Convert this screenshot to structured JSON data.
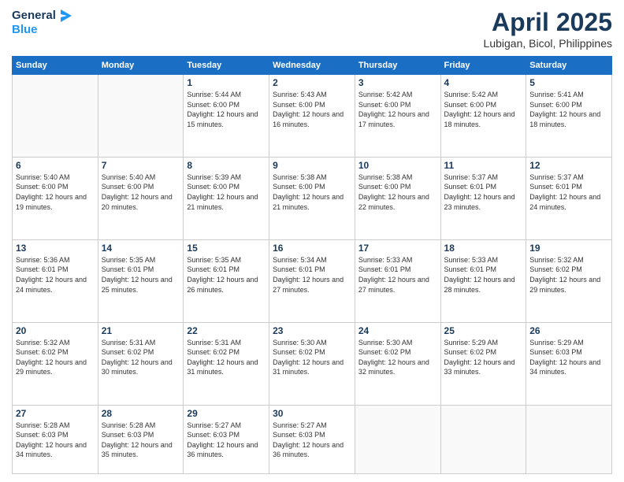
{
  "logo": {
    "line1": "General",
    "line2": "Blue"
  },
  "title": {
    "month": "April 2025",
    "location": "Lubigan, Bicol, Philippines"
  },
  "weekdays": [
    "Sunday",
    "Monday",
    "Tuesday",
    "Wednesday",
    "Thursday",
    "Friday",
    "Saturday"
  ],
  "days": [
    {
      "num": "",
      "info": ""
    },
    {
      "num": "",
      "info": ""
    },
    {
      "num": "1",
      "sunrise": "5:44 AM",
      "sunset": "6:00 PM",
      "daylight": "12 hours and 15 minutes."
    },
    {
      "num": "2",
      "sunrise": "5:43 AM",
      "sunset": "6:00 PM",
      "daylight": "12 hours and 16 minutes."
    },
    {
      "num": "3",
      "sunrise": "5:42 AM",
      "sunset": "6:00 PM",
      "daylight": "12 hours and 17 minutes."
    },
    {
      "num": "4",
      "sunrise": "5:42 AM",
      "sunset": "6:00 PM",
      "daylight": "12 hours and 18 minutes."
    },
    {
      "num": "5",
      "sunrise": "5:41 AM",
      "sunset": "6:00 PM",
      "daylight": "12 hours and 18 minutes."
    },
    {
      "num": "6",
      "sunrise": "5:40 AM",
      "sunset": "6:00 PM",
      "daylight": "12 hours and 19 minutes."
    },
    {
      "num": "7",
      "sunrise": "5:40 AM",
      "sunset": "6:00 PM",
      "daylight": "12 hours and 20 minutes."
    },
    {
      "num": "8",
      "sunrise": "5:39 AM",
      "sunset": "6:00 PM",
      "daylight": "12 hours and 21 minutes."
    },
    {
      "num": "9",
      "sunrise": "5:38 AM",
      "sunset": "6:00 PM",
      "daylight": "12 hours and 21 minutes."
    },
    {
      "num": "10",
      "sunrise": "5:38 AM",
      "sunset": "6:00 PM",
      "daylight": "12 hours and 22 minutes."
    },
    {
      "num": "11",
      "sunrise": "5:37 AM",
      "sunset": "6:01 PM",
      "daylight": "12 hours and 23 minutes."
    },
    {
      "num": "12",
      "sunrise": "5:37 AM",
      "sunset": "6:01 PM",
      "daylight": "12 hours and 24 minutes."
    },
    {
      "num": "13",
      "sunrise": "5:36 AM",
      "sunset": "6:01 PM",
      "daylight": "12 hours and 24 minutes."
    },
    {
      "num": "14",
      "sunrise": "5:35 AM",
      "sunset": "6:01 PM",
      "daylight": "12 hours and 25 minutes."
    },
    {
      "num": "15",
      "sunrise": "5:35 AM",
      "sunset": "6:01 PM",
      "daylight": "12 hours and 26 minutes."
    },
    {
      "num": "16",
      "sunrise": "5:34 AM",
      "sunset": "6:01 PM",
      "daylight": "12 hours and 27 minutes."
    },
    {
      "num": "17",
      "sunrise": "5:33 AM",
      "sunset": "6:01 PM",
      "daylight": "12 hours and 27 minutes."
    },
    {
      "num": "18",
      "sunrise": "5:33 AM",
      "sunset": "6:01 PM",
      "daylight": "12 hours and 28 minutes."
    },
    {
      "num": "19",
      "sunrise": "5:32 AM",
      "sunset": "6:02 PM",
      "daylight": "12 hours and 29 minutes."
    },
    {
      "num": "20",
      "sunrise": "5:32 AM",
      "sunset": "6:02 PM",
      "daylight": "12 hours and 29 minutes."
    },
    {
      "num": "21",
      "sunrise": "5:31 AM",
      "sunset": "6:02 PM",
      "daylight": "12 hours and 30 minutes."
    },
    {
      "num": "22",
      "sunrise": "5:31 AM",
      "sunset": "6:02 PM",
      "daylight": "12 hours and 31 minutes."
    },
    {
      "num": "23",
      "sunrise": "5:30 AM",
      "sunset": "6:02 PM",
      "daylight": "12 hours and 31 minutes."
    },
    {
      "num": "24",
      "sunrise": "5:30 AM",
      "sunset": "6:02 PM",
      "daylight": "12 hours and 32 minutes."
    },
    {
      "num": "25",
      "sunrise": "5:29 AM",
      "sunset": "6:02 PM",
      "daylight": "12 hours and 33 minutes."
    },
    {
      "num": "26",
      "sunrise": "5:29 AM",
      "sunset": "6:03 PM",
      "daylight": "12 hours and 34 minutes."
    },
    {
      "num": "27",
      "sunrise": "5:28 AM",
      "sunset": "6:03 PM",
      "daylight": "12 hours and 34 minutes."
    },
    {
      "num": "28",
      "sunrise": "5:28 AM",
      "sunset": "6:03 PM",
      "daylight": "12 hours and 35 minutes."
    },
    {
      "num": "29",
      "sunrise": "5:27 AM",
      "sunset": "6:03 PM",
      "daylight": "12 hours and 36 minutes."
    },
    {
      "num": "30",
      "sunrise": "5:27 AM",
      "sunset": "6:03 PM",
      "daylight": "12 hours and 36 minutes."
    }
  ]
}
